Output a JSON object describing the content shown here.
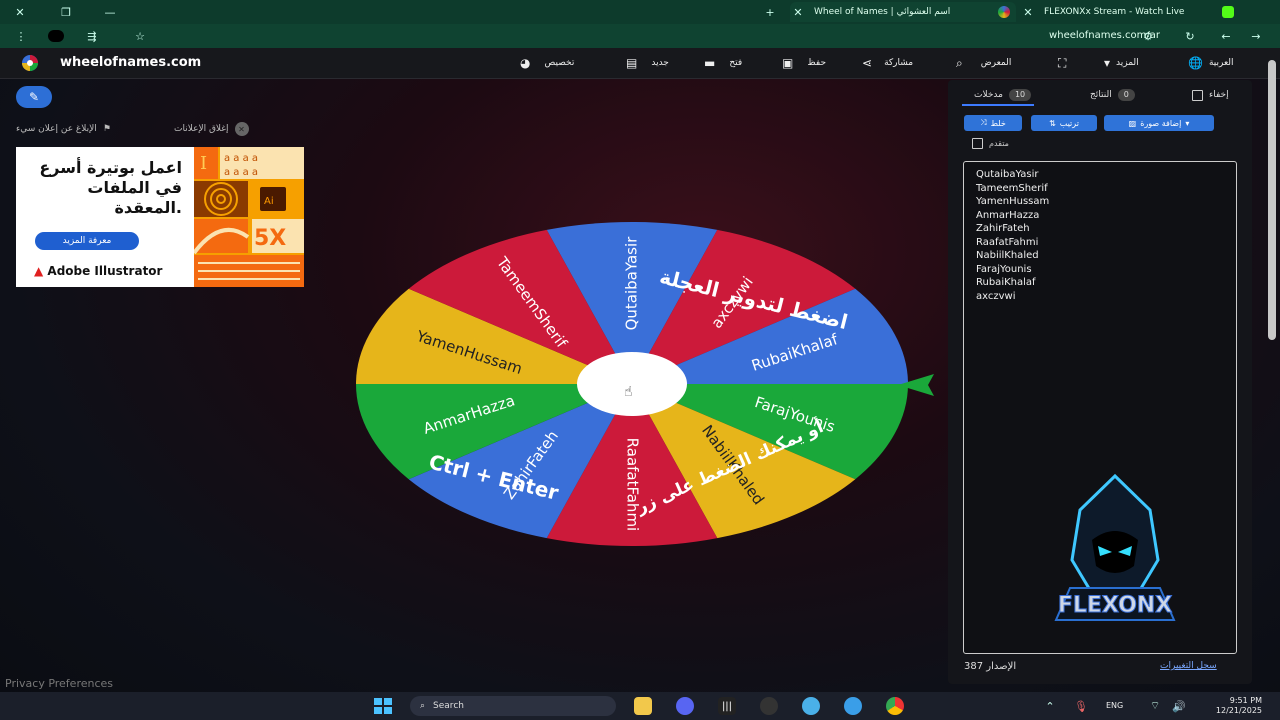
{
  "browser": {
    "tabs": [
      {
        "title": "Wheel of Names | اسم العشوائي"
      },
      {
        "title": "FLEXONXx Stream - Watch Live"
      }
    ],
    "url": "wheelofnames.com/ar"
  },
  "header": {
    "logo_text": "wheelofnames.com",
    "menu": [
      {
        "label": "العربية",
        "icon": "globe-icon"
      },
      {
        "label": "المزيد",
        "icon": "dropdown-icon"
      },
      {
        "label": "",
        "icon": "fullscreen-icon"
      },
      {
        "label": "المعرض",
        "icon": "search-icon"
      },
      {
        "label": "مشاركة",
        "icon": "share-icon"
      },
      {
        "label": "حفظ",
        "icon": "save-icon"
      },
      {
        "label": "فتح",
        "icon": "folder-icon"
      },
      {
        "label": "جديد",
        "icon": "file-icon"
      },
      {
        "label": "تخصيص",
        "icon": "palette-icon"
      }
    ]
  },
  "ads": {
    "report_label": "الإبلاغ عن إعلان سيء",
    "close_label": "إغلاق الإعلانات",
    "text": "اعمل بوتيرة أسرع في الملفات المعقدة.",
    "button": "معرفة المزيد",
    "brand": "Adobe Illustrator",
    "badge": "5X",
    "ai_label": "Ai"
  },
  "wheel": {
    "center_prompt": "اضغط لتدوير العجلة",
    "hint_line1": "أو يمكنك الضغط على زر",
    "hint_line2": "Ctrl + Enter",
    "segments": [
      {
        "name": "QutaibaYasir",
        "color": "#3a6fd8"
      },
      {
        "name": "axczvwi",
        "color": "#cc1a3a"
      },
      {
        "name": "RubaiKhalaf",
        "color": "#3a6fd8"
      },
      {
        "name": "FarajYounis",
        "color": "#1aa83a"
      },
      {
        "name": "NabiilKhaled",
        "color": "#e6b51a"
      },
      {
        "name": "RaafatFahmi",
        "color": "#cc1a3a"
      },
      {
        "name": "ZahirFateh",
        "color": "#3a6fd8"
      },
      {
        "name": "AnmarHazza",
        "color": "#1aa83a"
      },
      {
        "name": "YamenHussam",
        "color": "#e6b51a"
      },
      {
        "name": "TameemSherif",
        "color": "#cc1a3a"
      }
    ]
  },
  "panel": {
    "tabs": {
      "entries_label": "مدخلات",
      "entries_count": "10",
      "results_label": "النتائج",
      "results_count": "0",
      "hide_label": "إخفاء"
    },
    "buttons": {
      "shuffle": "خلط",
      "sort": "ترتيب",
      "add_image": "إضافة صورة"
    },
    "advanced_label": "متقدم",
    "entries": [
      "QutaibaYasir",
      "TameemSherif",
      "YamenHussam",
      "AnmarHazza",
      "ZahirFateh",
      "RaafatFahmi",
      "NabiilKhaled",
      "FarajYounis",
      "RubaiKhalaf",
      "axczvwi"
    ],
    "version_label": "الإصدار",
    "version_number": "387",
    "changelog": "سجل التغييرات"
  },
  "watermark": {
    "text": "FLEXONX"
  },
  "footer": {
    "privacy": "Privacy Preferences"
  },
  "taskbar": {
    "search": "Search",
    "lang": "ENG",
    "time": "9:51 PM",
    "date": "12/21/2025"
  },
  "colors": {
    "accent": "#2f73d8",
    "header_bg": "#17181c",
    "chrome_green": "#0f4331"
  }
}
